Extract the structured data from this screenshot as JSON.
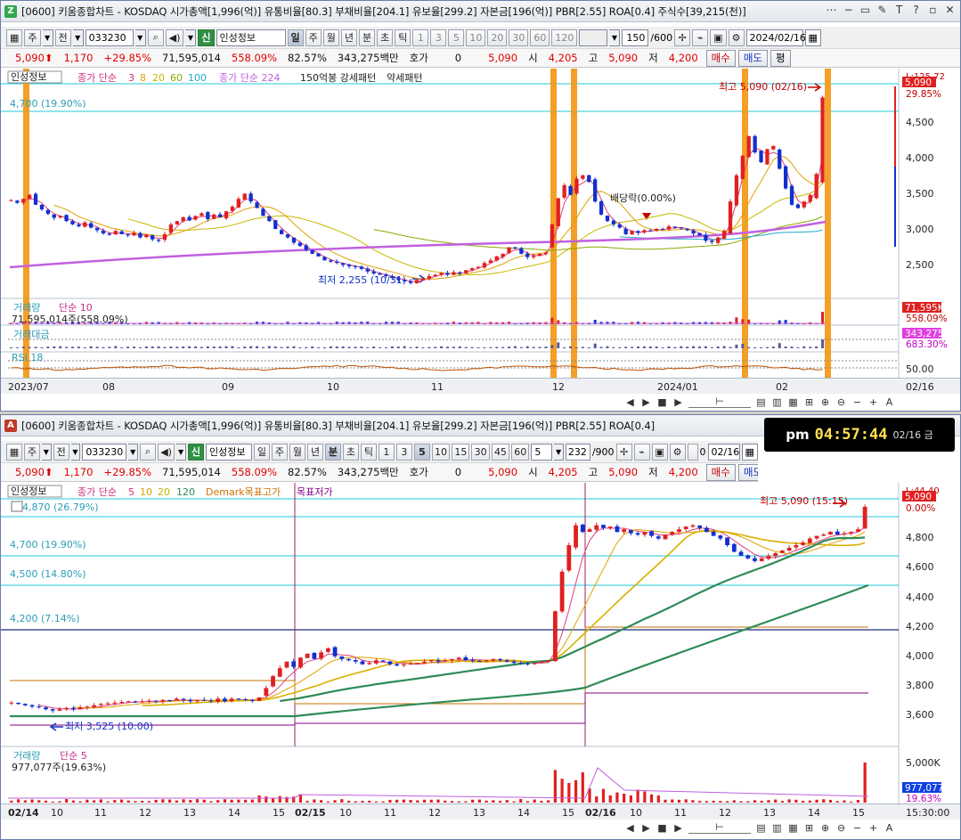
{
  "app": {
    "windows": [
      {
        "id": "daily",
        "badge": "Z",
        "badge_color": "#2fa84f",
        "title": "[0600] 키움종합차트 - KOSDAQ 시가총액[1,996(억)] 유통비율[80.3] 부채비율[204.1] 유보율[299.2] 자본금[196(억)] PBR[2.55] ROA[0.4] 주식수[39,215(천)]",
        "window_ctrls": [
          "⋯",
          "−",
          "▭",
          "✎",
          "T",
          "?",
          "▫",
          "✕"
        ],
        "toolbar": {
          "mode": "주",
          "kind": "전",
          "code": "033230",
          "info_btn": "신",
          "info_label": "인성정보",
          "periods": [
            "일",
            "주",
            "월",
            "년",
            "분",
            "초",
            "틱"
          ],
          "active_period": "일",
          "intervals": [
            "1",
            "3",
            "5",
            "10",
            "20",
            "30",
            "60",
            "120"
          ],
          "count": "150",
          "count_total": "/600",
          "date": "2024/02/16"
        },
        "quote": {
          "price": "5,090",
          "arrow": "⬆",
          "change": "1,170",
          "pct": "+29.85%",
          "volume": "71,595,014",
          "vol_pct": "558.09%",
          "turn": "82.57%",
          "amount": "343,275백만",
          "hoga_label": "호가",
          "hoga_val": "0",
          "hoga_price": "5,090",
          "open_label": "시",
          "open": "4,205",
          "high_label": "고",
          "high": "5,090",
          "low_label": "저",
          "low": "4,200",
          "buy": "매수",
          "sell": "매도",
          "eval": "평"
        },
        "legend": {
          "name": "인성정보",
          "ma_label": "종가 단순",
          "ma_periods": [
            "3",
            "8",
            "20",
            "60",
            "100"
          ],
          "ma_long": "종가 단순 224",
          "pattern": "150억봉 강세패턴",
          "weak": "약세패턴"
        },
        "price_labels": {
          "top": "5,090",
          "top_pct": "29.85%",
          "ref_line": "4,700 (19.90%)",
          "max_label": "최고 5,090 (02/16)",
          "min_label": "최저 2,255 (10/31)",
          "div_label": "배당락(0.00%)",
          "corner": "L:125.72"
        },
        "y_ticks": [
          "4,500",
          "4,000",
          "3,500",
          "3,000",
          "2,500"
        ],
        "vol_panel": {
          "title": "거래량",
          "ma": "단순 10",
          "value": "71,595,014주(558.09%)",
          "badge": "71,595K",
          "badge_pct": "558.09%"
        },
        "amt_panel": {
          "title": "거래대금",
          "badge": "343,275",
          "badge_pct": "683.30%"
        },
        "rsi_panel": {
          "title": "RSI 18",
          "level": "50.00"
        },
        "x_labels": [
          "2023/07",
          "08",
          "09",
          "10",
          "11",
          "12",
          "2024/01",
          "02"
        ],
        "x_right": "02/16"
      },
      {
        "id": "minute",
        "badge": "A",
        "badge_color": "#c0392b",
        "title": "[0600] 키움종합차트 - KOSDAQ 시가총액[1,996(억)] 유통비율[80.3] 부채비율[204.1] 유보율[299.2] 자본금[196(억)] PBR[2.55] ROA[0.4]",
        "window_ctrls": [
          "⋯",
          "−",
          "▭",
          "✎",
          "T",
          "?",
          "▫",
          "✕"
        ],
        "toolbar": {
          "mode": "주",
          "kind": "전",
          "code": "033230",
          "info_btn": "신",
          "info_label": "인성정보",
          "periods": [
            "일",
            "주",
            "월",
            "년",
            "분",
            "초",
            "틱"
          ],
          "active_period": "분",
          "intervals": [
            "1",
            "3",
            "5",
            "10",
            "15",
            "30",
            "45",
            "60"
          ],
          "active_interval": "5",
          "unit": "5",
          "count": "232",
          "count_total": "/900",
          "check": "0",
          "date": "02/16"
        },
        "clock": {
          "ampm": "pm",
          "time": "04:57:44",
          "date": "02/16 금"
        },
        "quote": {
          "price": "5,090",
          "arrow": "⬆",
          "change": "1,170",
          "pct": "+29.85%",
          "volume": "71,595,014",
          "vol_pct": "558.09%",
          "turn": "82.57%",
          "amount": "343,275백만",
          "hoga_label": "호가",
          "hoga_val": "0",
          "hoga_price": "5,090",
          "open_label": "시",
          "open": "4,205",
          "high_label": "고",
          "high": "5,090",
          "low_label": "저",
          "low": "4,200",
          "buy": "매수",
          "sell": "매도",
          "eval": "평"
        },
        "legend": {
          "name": "인성정보",
          "ma_label": "종가 단순",
          "ma_periods": [
            "5",
            "10",
            "20",
            "120"
          ],
          "demark_hi": "Demark목표고가",
          "demark_lo": "목표저가"
        },
        "price_labels": {
          "top": "5,090",
          "top_pct": "0.00%",
          "ref1": "4,870 (26.79%)",
          "ref2": "4,700 (19.90%)",
          "ref3": "4,500 (14.80%)",
          "ref4": "4,200 (7.14%)",
          "max_label": "최고 5,090 (15:15)",
          "min_label": "최저 3,525 (10:00)",
          "corner": "L:44.40"
        },
        "y_ticks": [
          "4,800",
          "4,600",
          "4,400",
          "4,200",
          "4,000",
          "3,800",
          "3,600"
        ],
        "vol_panel": {
          "title": "거래량",
          "ma": "단순 5",
          "value": "977,077주(19.63%)",
          "top": "5,000K",
          "badge": "977,077",
          "badge_pct": "19.63%"
        },
        "x_labels": [
          "02/14",
          "10",
          "11",
          "12",
          "13",
          "14",
          "15",
          "02/15",
          "10",
          "11",
          "12",
          "13",
          "14",
          "15",
          "02/16",
          "10",
          "11",
          "12",
          "13",
          "14",
          "15"
        ],
        "x_right": "15:30:00"
      }
    ]
  },
  "colors": {
    "up": "#e02020",
    "down": "#1030d0",
    "cyan": "#22c8d8",
    "orange": "#f39a1b",
    "purple": "#c060e0",
    "green": "#2e8b57",
    "navy": "#1a2f80"
  },
  "chart_data": [
    {
      "type": "candlestick",
      "title": "인성정보 일봉",
      "ylim": [
        2100,
        5300
      ],
      "close": [
        3520,
        3480,
        3540,
        3600,
        3450,
        3380,
        3310,
        3250,
        3280,
        3200,
        3150,
        3120,
        3180,
        3100,
        3060,
        3010,
        2990,
        3050,
        3000,
        2980,
        3020,
        2950,
        2990,
        2920,
        2900,
        3000,
        3150,
        3200,
        3260,
        3210,
        3280,
        3320,
        3230,
        3300,
        3260,
        3350,
        3420,
        3540,
        3620,
        3500,
        3400,
        3280,
        3200,
        3080,
        3000,
        2950,
        2870,
        2820,
        2760,
        2700,
        2660,
        2600,
        2580,
        2560,
        2530,
        2510,
        2500,
        2470,
        2430,
        2400,
        2380,
        2360,
        2330,
        2300,
        2280,
        2255,
        2300,
        2320,
        2360,
        2380,
        2410,
        2380,
        2420,
        2400,
        2450,
        2480,
        2500,
        2560,
        2600,
        2660,
        2700,
        2800,
        2780,
        2700,
        2650,
        2670,
        2700,
        2720,
        3150,
        3550,
        3750,
        3600,
        3850,
        3900,
        3800,
        3500,
        3300,
        3200,
        3150,
        3100,
        3000,
        3050,
        3020,
        3060,
        3050,
        3080,
        3070,
        3120,
        3100,
        3090,
        3060,
        3010,
        2980,
        2900,
        2880,
        2950,
        3050,
        3500,
        3900,
        4200,
        4500,
        4250,
        4100,
        4300,
        4350,
        4000,
        3700,
        3450,
        3400,
        3500,
        3600,
        3920,
        5090
      ]
    },
    {
      "type": "candlestick",
      "title": "인성정보 5분봉",
      "ylim": [
        3400,
        5150
      ],
      "close": [
        3610,
        3600,
        3590,
        3580,
        3575,
        3560,
        3550,
        3560,
        3570,
        3560,
        3575,
        3580,
        3590,
        3600,
        3605,
        3610,
        3615,
        3620,
        3615,
        3620,
        3625,
        3620,
        3630,
        3625,
        3640,
        3630,
        3620,
        3630,
        3625,
        3620,
        3640,
        3620,
        3640,
        3635,
        3630,
        3625,
        3650,
        3720,
        3810,
        3870,
        3920,
        3880,
        3950,
        3980,
        3940,
        3990,
        4020,
        3960,
        3940,
        3930,
        3920,
        3900,
        3910,
        3930,
        3920,
        3900,
        3890,
        3900,
        3905,
        3910,
        3920,
        3930,
        3920,
        3930,
        3940,
        3950,
        3930,
        3925,
        3920,
        3930,
        3940,
        3930,
        3920,
        3910,
        3905,
        3900,
        3910,
        3920,
        3930,
        4300,
        4600,
        4800,
        4950,
        4900,
        4920,
        4950,
        4930,
        4940,
        4900,
        4920,
        4890,
        4880,
        4900,
        4870,
        4850,
        4880,
        4900,
        4920,
        4940,
        4950,
        4930,
        4900,
        4870,
        4850,
        4800,
        4750,
        4720,
        4700,
        4680,
        4700,
        4720,
        4740,
        4760,
        4780,
        4800,
        4820,
        4850,
        4870,
        4880,
        4900,
        4880,
        4890,
        4900,
        4920,
        5090
      ]
    }
  ]
}
